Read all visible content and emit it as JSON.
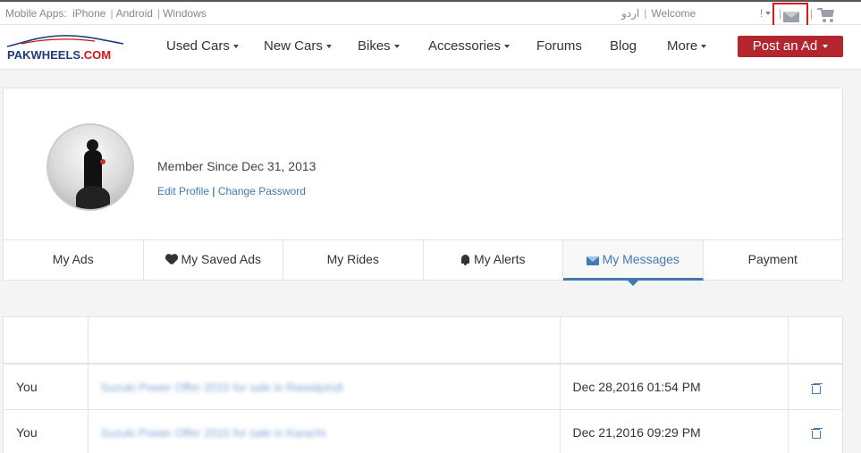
{
  "topbar": {
    "apps_label": "Mobile Apps:",
    "iphone": "iPhone",
    "android": "Android",
    "windows": "Windows",
    "urdu": "اردو",
    "welcome": "Welcome",
    "bang": "!",
    "pipe": "|"
  },
  "nav": {
    "logo_text_a": "PAKWHEELS",
    "logo_text_b": ".COM",
    "items": [
      {
        "label": "Used Cars",
        "dropdown": true
      },
      {
        "label": "New Cars",
        "dropdown": true
      },
      {
        "label": "Bikes",
        "dropdown": true
      },
      {
        "label": "Accessories",
        "dropdown": true
      },
      {
        "label": "Forums",
        "dropdown": false
      },
      {
        "label": "Blog",
        "dropdown": false
      },
      {
        "label": "More",
        "dropdown": true
      }
    ],
    "post_ad": "Post an Ad"
  },
  "profile": {
    "member_since": "Member Since Dec 31, 2013",
    "edit_profile": "Edit Profile",
    "separator": "|",
    "change_password": "Change Password"
  },
  "tabs": [
    {
      "label": "My Ads",
      "icon": "",
      "active": false
    },
    {
      "label": "My Saved Ads",
      "icon": "heart-icon",
      "active": false
    },
    {
      "label": "My Rides",
      "icon": "",
      "active": false
    },
    {
      "label": "My Alerts",
      "icon": "bell-icon",
      "active": false
    },
    {
      "label": "My Messages",
      "icon": "envelope-icon",
      "active": true
    },
    {
      "label": "Payment",
      "icon": "",
      "active": false
    }
  ],
  "messages": {
    "rows": [
      {
        "from": "You",
        "subject": "Suzuki Power Offer 2015 for sale in Rawalpindi",
        "date": "Dec 28,2016 01:54 PM"
      },
      {
        "from": "You",
        "subject": "Suzuki Power Offer 2015 for sale in Karachi",
        "date": "Dec 21,2016 09:29 PM"
      }
    ]
  },
  "colors": {
    "accent": "#3f7ab5",
    "post_button": "#b3262e",
    "highlight_box": "#e0161a"
  }
}
